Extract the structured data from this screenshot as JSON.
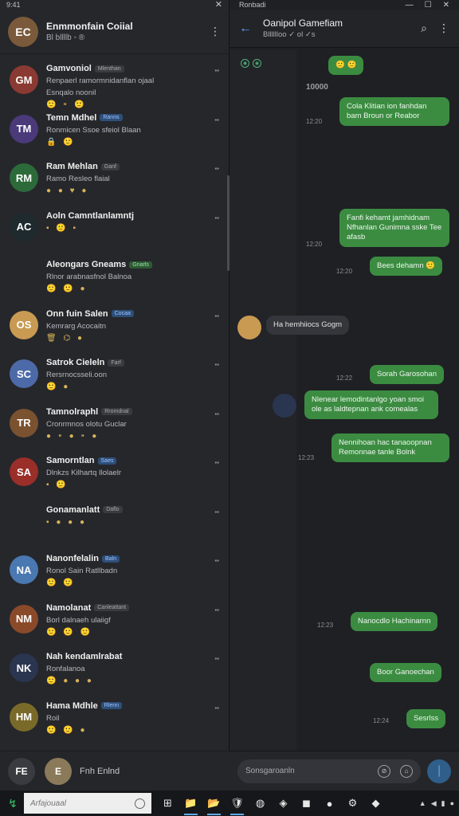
{
  "left_pane": {
    "status_time": "9:41",
    "account": {
      "name": "Enmmonfain Coiial",
      "sub": "Bl bllllb ◦ ®",
      "initials": "EC",
      "color": "#7a5a3a"
    },
    "chats": [
      {
        "name": "Gamvoniol",
        "tag": "Mlenthan",
        "tag_kind": "grey",
        "preview": "Renpaerl ramormnidanflan ojaal",
        "preview2": "Esnqalo noonil",
        "emojis": "🙂 ⁍ 🙂",
        "time": "▪▪",
        "initials": "GM",
        "color": "#8a3a32"
      },
      {
        "name": "Temn Mdhel",
        "tag": "Ranns",
        "tag_kind": "blue",
        "preview": "Ronmicen Ssoe sfeiol Blaan",
        "emojis": "🔒 🙂",
        "time": "▪▪",
        "initials": "TM",
        "color": "#4a3a7a"
      },
      {
        "name": "Ram Mehlan",
        "tag": "Ganf",
        "tag_kind": "grey",
        "preview": "Ramo Resleo flaial",
        "emojis": "● ● ♥ ●",
        "time": "▪▪",
        "initials": "RM",
        "color": "#2d6a3a"
      },
      {
        "name": "Aoln Camntlanlamntj",
        "tag": "",
        "tag_kind": "grey",
        "preview": "",
        "emojis": "▪ 🙂 ▪",
        "time": "▪▪",
        "initials": "AC",
        "color": "#1e2a2e"
      },
      {
        "name": "Aleongars Gneams",
        "tag": "Gnarls",
        "tag_kind": "green",
        "preview": "Rlnor arabnasfnol Balnoa",
        "emojis": "🙂 🙂 ●",
        "time": "",
        "initials": "",
        "color": "#26272b"
      },
      {
        "name": "Onn fuin Salen",
        "tag": "Cocaa",
        "tag_kind": "blue",
        "preview": "Kemrarg Acocaitn",
        "emojis": "🗑 ⌬ ●",
        "time": "▪▪",
        "initials": "OS",
        "color": "#c89a52"
      },
      {
        "name": "Satrok Cieleln",
        "tag": "Farf",
        "tag_kind": "grey",
        "preview": "Rersrnocsseli.oon",
        "emojis": "🙂 ●",
        "time": "▪▪",
        "initials": "SC",
        "color": "#4d6aa8"
      },
      {
        "name": "Tamnolraphl",
        "tag": "Rromdnal",
        "tag_kind": "grey",
        "preview": "Cronrmnos olotu Guclar",
        "emojis": "● ⁍ ● ⁍ ●",
        "time": "▪▪",
        "initials": "TR",
        "color": "#7a5230"
      },
      {
        "name": "Samorntlan",
        "tag": "Saes",
        "tag_kind": "blue",
        "preview": "Dlnkzs Kilhartq Ilolaelr",
        "emojis": "▪ 🙂",
        "time": "▪▪",
        "initials": "SA",
        "color": "#9a2e28"
      },
      {
        "name": "Gonamanlatt",
        "tag": "Daflo",
        "tag_kind": "grey",
        "preview": "",
        "emojis": "▪ ● ● ●",
        "time": "▪▪",
        "initials": "",
        "color": "#26272b"
      },
      {
        "name": "Nanonfelalin",
        "tag": "Baln",
        "tag_kind": "blue",
        "preview": "Ronol Sain Ratllbadn",
        "emojis": "🙂 🙂",
        "time": "▪▪",
        "initials": "NA",
        "color": "#4a78b0"
      },
      {
        "name": "Namolanat",
        "tag": "Canleattant",
        "tag_kind": "grey",
        "preview": "Borl dalnaeh ulaiigf",
        "emojis": "🙂 🙂 🙂",
        "time": "▪▪",
        "initials": "NM",
        "color": "#8a4a2a"
      },
      {
        "name": "Nah kendamlrabat",
        "tag": "",
        "tag_kind": "grey",
        "preview": "Ronfalanoa",
        "emojis": "🙂 ● ● ●",
        "time": "▪▪",
        "initials": "NK",
        "color": "#2a3550"
      },
      {
        "name": "Hama Mdhle",
        "tag": "Rlenn",
        "tag_kind": "blue",
        "preview": "Roil",
        "emojis": "🙂 🙂 ●",
        "time": "▪▪",
        "initials": "HM",
        "color": "#7a6a2a"
      }
    ],
    "footer": {
      "label": "Fnh Enlnd",
      "initials": "FE",
      "mini_initials": "E"
    }
  },
  "right_pane": {
    "status_title": "Ronbadi",
    "header": {
      "name": "Oanipol Gamefiam",
      "sub": "Blllllloo ✓ ol ✓s"
    },
    "date_label": "10000",
    "messages": [
      {
        "dir": "out",
        "text": "🙂 🙂",
        "time": ""
      },
      {
        "dir": "out",
        "text": "Cola Klitian ion fanhdan bam Broun or Reabor",
        "time": "12:20"
      },
      {
        "dir": "out",
        "text": "Fanfi kehamt jamhidnam Nfhanlan Gunimna sske Tee afasb",
        "time": "12:20"
      },
      {
        "dir": "out",
        "text": "Bees dehamn 🙂",
        "time": "12:20"
      },
      {
        "dir": "in",
        "text": "Ha hemhiiocs Gogm",
        "time": ""
      },
      {
        "dir": "out",
        "text": "Sorah Garosohan",
        "time": "12:22"
      },
      {
        "dir": "out",
        "text": "Nlenear lemodintanlgo yoan smoi ole as laldtepnan ank comealas",
        "time": ""
      },
      {
        "dir": "out",
        "text": "Nennihoan hac tanaoopnan Remonnae tanle Bolnk",
        "time": "12:23"
      },
      {
        "dir": "out",
        "text": "Nanocdlo Hachinarnn",
        "time": "12:23"
      },
      {
        "dir": "out",
        "text": "Boor Ganoechan",
        "time": ""
      },
      {
        "dir": "out",
        "text": "Sesrlss",
        "time": "12:24"
      }
    ],
    "composer": {
      "placeholder": "Sonsgaroanln"
    }
  },
  "taskbar": {
    "search_placeholder": "Arfajouaal",
    "apps": [
      "⊞",
      "📁",
      "📂",
      "🛡",
      "◍",
      "◈",
      "◼",
      "●",
      "⚙",
      "◆"
    ],
    "tray": [
      "▲",
      "◀",
      "▮",
      "●"
    ]
  },
  "colors": {
    "outgoing_bubble": "#3b8c41",
    "accent": "#5aa2ff",
    "background": "#1d1e22"
  }
}
